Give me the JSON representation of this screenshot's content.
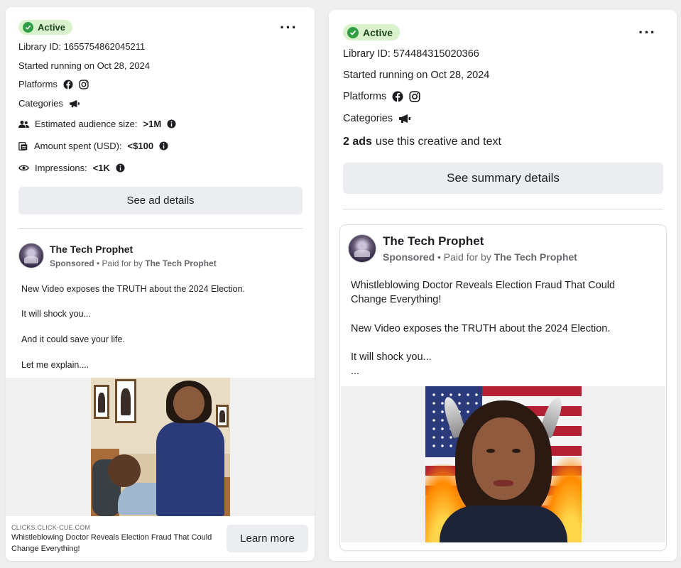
{
  "colors": {
    "active_bg": "#d9f2cc",
    "active_check": "#2f9e44",
    "button_bg": "#ebedf0",
    "secondary_text": "#65676b"
  },
  "left": {
    "status": "Active",
    "library_id": "Library ID: 1655754862045211",
    "started": "Started running on Oct 28, 2024",
    "platforms_label": "Platforms",
    "categories_label": "Categories",
    "audience_label": "Estimated audience size:",
    "audience_value": ">1M",
    "spent_label": "Amount spent (USD):",
    "spent_value": "<$100",
    "impressions_label": "Impressions:",
    "impressions_value": "<1K",
    "details_button": "See ad details",
    "advertiser": "The Tech Prophet",
    "sponsored": "Sponsored",
    "paid_for_by": "• Paid for by",
    "paid_for_name": "The Tech Prophet",
    "body": [
      "New Video exposes the TRUTH about the 2024 Election.",
      "It will shock you...",
      "And it could save your life.",
      "Let me explain...."
    ],
    "link_domain": "CLICKS.CLICK-CUE.COM",
    "link_title_1": "Whistleblowing Doctor Reveals Election Fraud That Could",
    "link_title_2": "Change Everything!",
    "cta": "Learn more"
  },
  "right": {
    "status": "Active",
    "library_id": "Library ID: 574484315020366",
    "started": "Started running on Oct 28, 2024",
    "platforms_label": "Platforms",
    "categories_label": "Categories",
    "ads_count": "2 ads",
    "ads_text": "use this creative and text",
    "summary_button": "See summary details",
    "advertiser": "The Tech Prophet",
    "sponsored": "Sponsored",
    "paid_for_by": "• Paid for by",
    "paid_for_name": "The Tech Prophet",
    "body_1": "Whistleblowing Doctor Reveals Election Fraud That Could",
    "body_2": "Change Everything!",
    "body_3": "New Video exposes the TRUTH about the 2024 Election.",
    "body_4": "It will shock you...",
    "body_5": "..."
  },
  "icons": {
    "facebook": "facebook-icon",
    "instagram": "instagram-icon",
    "megaphone": "megaphone-icon",
    "people": "people-icon",
    "money": "money-icon",
    "eye": "eye-icon",
    "info": "info-icon",
    "more": "more-options-icon"
  }
}
